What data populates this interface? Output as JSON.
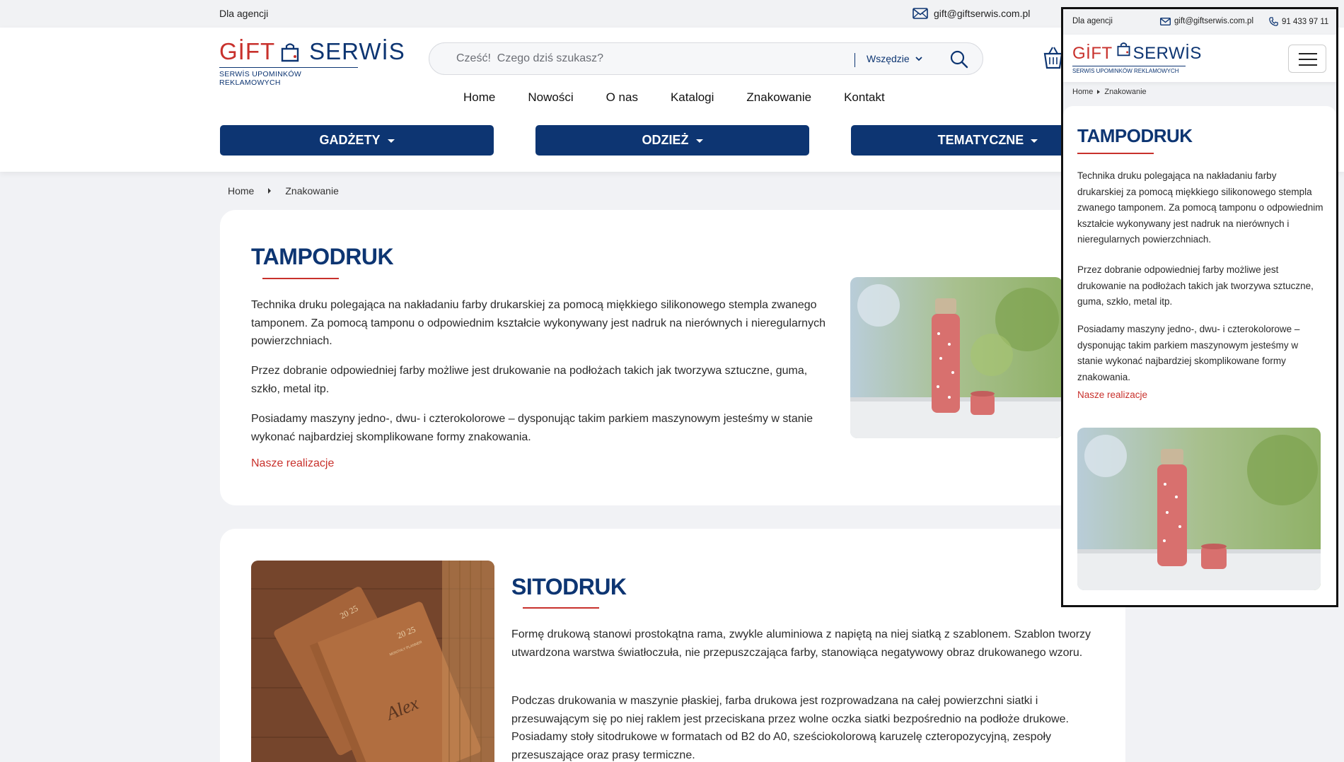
{
  "topbar": {
    "agency": "Dla agencji",
    "email": "gift@giftserwis.com.pl"
  },
  "header": {
    "logo_word_left": "GİFT",
    "logo_word_right": "SERWİS",
    "logo_tagline": "SERWİS UPOMINKÓW REKLAMOWYCH",
    "search_placeholder": "Cześć!  Czego dziś szukasz?",
    "search_scope": "Wszędzie",
    "nav": [
      "Home",
      "Nowości",
      "O nas",
      "Katalogi",
      "Znakowanie",
      "Kontakt"
    ],
    "categories": [
      "GADŻETY",
      "ODZIEŻ",
      "TEMATYCZNE"
    ]
  },
  "breadcrumb": {
    "home": "Home",
    "current": "Znakowanie"
  },
  "sections": {
    "tampodruk": {
      "title": "TAMPODRUK",
      "p1": "Technika druku polegająca na nakładaniu farby drukarskiej za pomocą miękkiego silikonowego stempla zwanego tamponem. Za pomocą tamponu o odpowiednim kształcie wykonywany jest nadruk na nierównych i nieregularnych powierzchniach.",
      "p2": "Przez dobranie odpowiedniej farby możliwe jest drukowanie na podłożach takich jak tworzywa sztuczne, guma, szkło, metal itp.",
      "p3": "Posiadamy maszyny jedno-, dwu- i czterokolorowe – dysponując takim parkiem maszynowym jesteśmy w stanie wykonać najbardziej skomplikowane formy znakowania.",
      "link": "Nasze realizacje"
    },
    "sitodruk": {
      "title": "SITODRUK",
      "p1": "Formę drukową stanowi prostokątna rama, zwykle aluminiowa z napiętą na niej siatką z szablonem. Szablon tworzy utwardzona warstwa światłoczuła, nie przepuszczająca farby, stanowiąca negatywowy obraz drukowanego wzoru.",
      "p2": "Podczas drukowania w maszynie płaskiej, farba drukowa jest rozprowadzana na całej powierzchni siatki i przesuwającym się po niej raklem jest przeciskana przez wolne oczka siatki bezpośrednio na podłoże drukowe. Posiadamy stoły sitodrukowe w formatach od B2 do A0, sześciokolorową karuzelę czteropozycyjną, zespoły przesuszające oraz prasy termiczne."
    }
  },
  "notebook_text": {
    "year": "20 25",
    "planner": "MONTHLY PLANNER",
    "name": "Alex"
  },
  "mobile": {
    "agency": "Dla agencji",
    "email": "gift@giftserwis.com.pl",
    "phone": "91 433 97 11",
    "breadcrumb_home": "Home",
    "breadcrumb_current": "Znakowanie",
    "title": "TAMPODRUK",
    "p1": "Technika druku polegająca na nakładaniu farby drukarskiej za pomocą miękkiego silikonowego stempla zwanego tamponem. Za pomocą tamponu o odpowiednim kształcie wykonywany jest nadruk na nierównych i nieregularnych powierzchniach.",
    "p2": "Przez dobranie odpowiedniej farby możliwe jest drukowanie na podłożach takich jak tworzywa sztuczne, guma, szkło, metal itp.",
    "p3": "Posiadamy maszyny jedno-, dwu- i czterokolorowe – dysponując takim parkiem maszynowym jesteśmy w stanie wykonać najbardziej skomplikowane formy znakowania.",
    "link": "Nasze realizacje"
  },
  "colors": {
    "brand_blue": "#0d3572",
    "brand_red": "#c8312c",
    "page_bg": "#f1f2f5"
  },
  "icons": [
    "mail-icon",
    "phone-icon",
    "search-icon",
    "chevron-down-icon",
    "cart-icon",
    "hamburger-icon",
    "breadcrumb-arrow-icon"
  ]
}
